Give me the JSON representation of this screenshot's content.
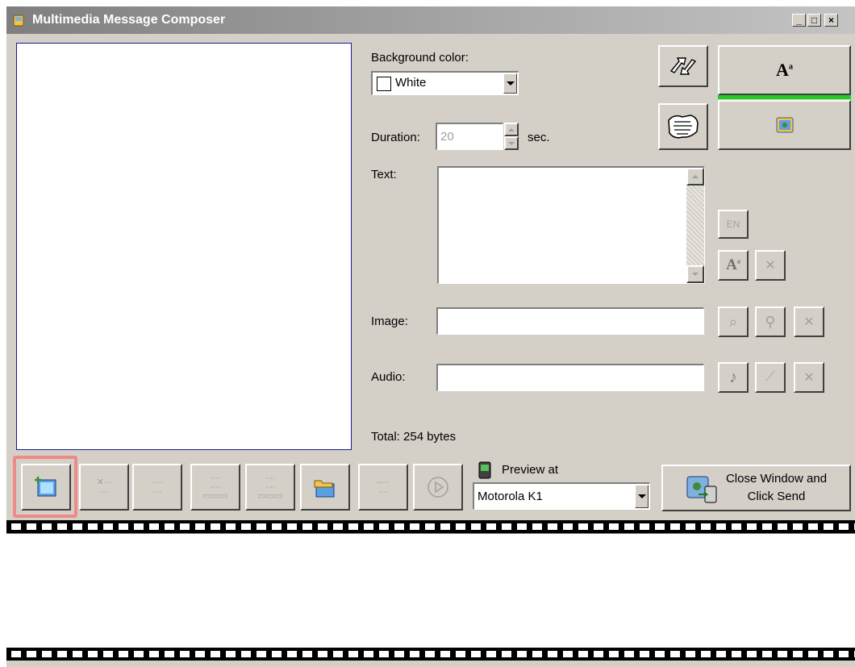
{
  "window": {
    "title": "Multimedia Message Composer",
    "controls": {
      "minimize": "_",
      "maximize": "□",
      "close": "×"
    }
  },
  "slide": {
    "background_label": "Background color:",
    "background_value": "White",
    "duration_label": "Duration:",
    "duration_value": "20",
    "duration_unit": "sec.",
    "text_label": "Text:",
    "text_value": "",
    "image_label": "Image:",
    "image_value": "",
    "audio_label": "Audio:",
    "audio_value": "",
    "total": "Total: 254 bytes"
  },
  "tools": {
    "text_style_glyph": "A",
    "text_style_sup": "a",
    "language_label": "EN",
    "accent_color": "#22cc22"
  },
  "preview": {
    "label": "Preview at",
    "device": "Motorola K1"
  },
  "send": {
    "label_line1": "Close Window and",
    "label_line2": "Click Send"
  },
  "icons": {
    "new_slide": "new-slide-icon",
    "delete_slide": "delete-slide-icon",
    "open_folder": "open-folder-icon",
    "play": "play-icon"
  }
}
